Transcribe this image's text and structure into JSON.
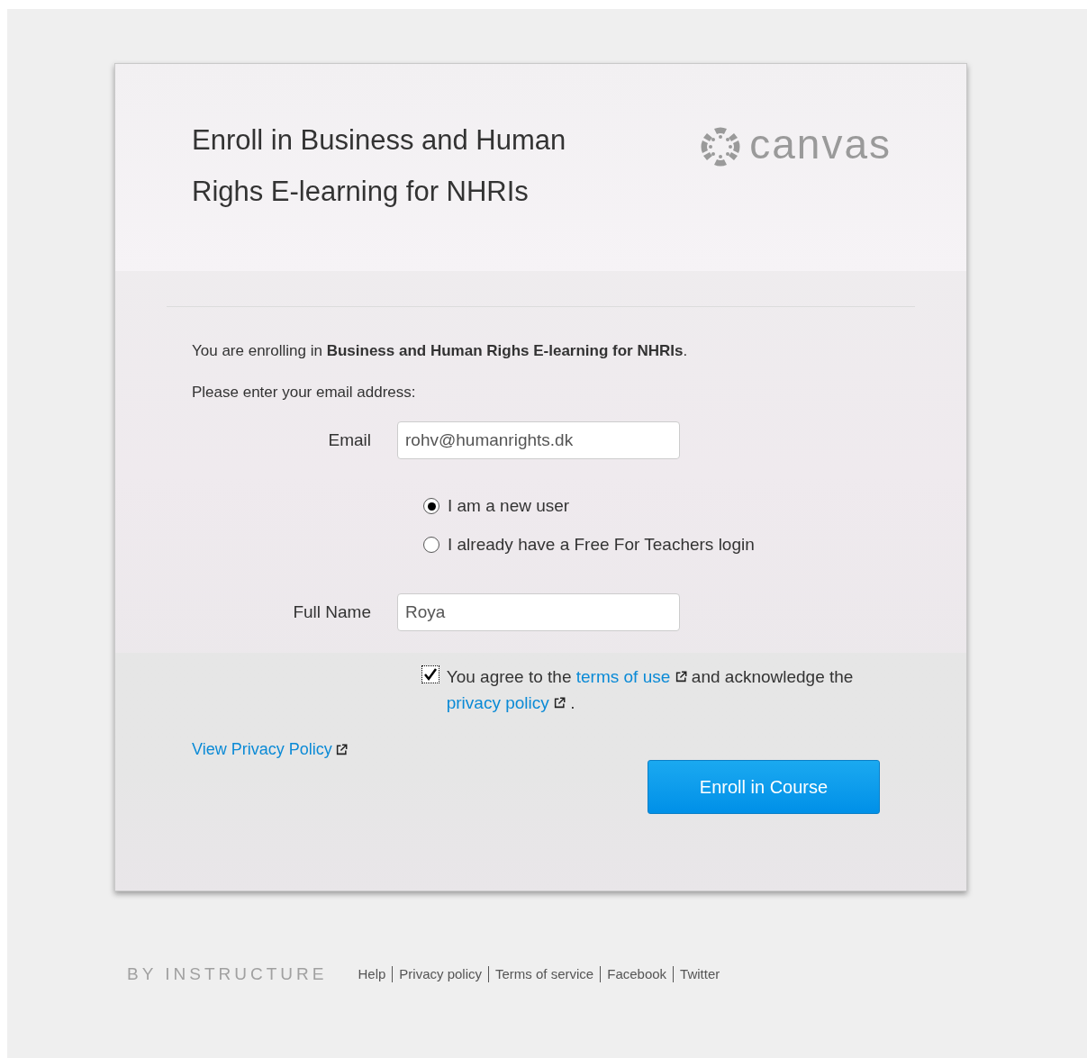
{
  "title": "Enroll in Business and Human Righs E-learning for NHRIs",
  "logo": {
    "wordmark": "canvas"
  },
  "intro": "You are enrolling in **Business and Human Righs E-learning for NHRIs**.",
  "prompt": "Please enter your email address:",
  "email": {
    "label": "Email",
    "value": "rohv@humanrights.dk"
  },
  "user_type": [
    {
      "label": "I am a new user",
      "selected": true
    },
    {
      "label": "I already have a Free For Teachers login",
      "selected": false
    }
  ],
  "full_name": {
    "label": "Full Name",
    "value": "Roya"
  },
  "agreement": {
    "checked": true,
    "before": "You agree to the",
    "terms_link": "terms of use",
    "middle": "and acknowledge the",
    "privacy_link": "privacy policy",
    "after": "."
  },
  "view_privacy_link": "View Privacy Policy",
  "submit_button": "Enroll in Course",
  "footer": {
    "brand": "BY INSTRUCTURE",
    "links": [
      "Help",
      "Privacy policy",
      "Terms of service",
      "Facebook",
      "Twitter"
    ]
  }
}
